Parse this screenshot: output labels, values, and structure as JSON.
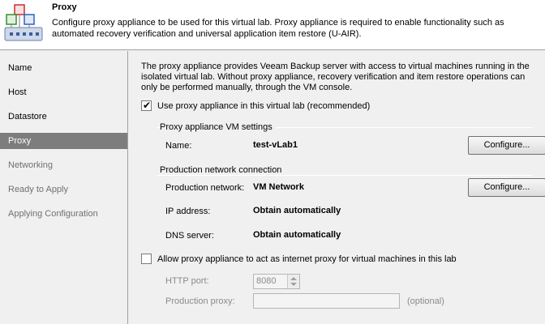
{
  "header": {
    "title": "Proxy",
    "description": "Configure proxy appliance to be used for this virtual lab. Proxy appliance is required to enable functionality such as automated recovery verification and universal application item restore (U-AIR)."
  },
  "sidebar": {
    "items": [
      {
        "label": "Name"
      },
      {
        "label": "Host"
      },
      {
        "label": "Datastore"
      },
      {
        "label": "Proxy"
      },
      {
        "label": "Networking"
      },
      {
        "label": "Ready to Apply"
      },
      {
        "label": "Applying Configuration"
      }
    ]
  },
  "main": {
    "intro": "The proxy appliance provides Veeam Backup server with access to virtual machines running in the isolated virtual lab. Without proxy appliance, recovery verification and item restore operations can only be performed manually, through the VM console.",
    "use_proxy": {
      "label": "Use proxy appliance in this virtual lab (recommended)",
      "checked": true
    },
    "vm_settings": {
      "title": "Proxy appliance VM settings",
      "name_label": "Name:",
      "name_value": "test-vLab1",
      "configure_label": "Configure..."
    },
    "production": {
      "title": "Production network connection",
      "network_label": "Production network:",
      "network_value": "VM Network",
      "configure_label": "Configure...",
      "ip_label": "IP address:",
      "ip_value": "Obtain automatically",
      "dns_label": "DNS server:",
      "dns_value": "Obtain automatically"
    },
    "internet_proxy": {
      "label": "Allow proxy appliance to act as internet proxy for virtual machines in this lab",
      "checked": false,
      "http_port_label": "HTTP port:",
      "http_port_value": "8080",
      "production_proxy_label": "Production proxy:",
      "production_proxy_value": "",
      "optional_label": "(optional)"
    }
  },
  "colors": {
    "active_item_bg": "#7d7d7d",
    "header_bg": "#ffffff",
    "window_bg": "#f0f0f0"
  }
}
